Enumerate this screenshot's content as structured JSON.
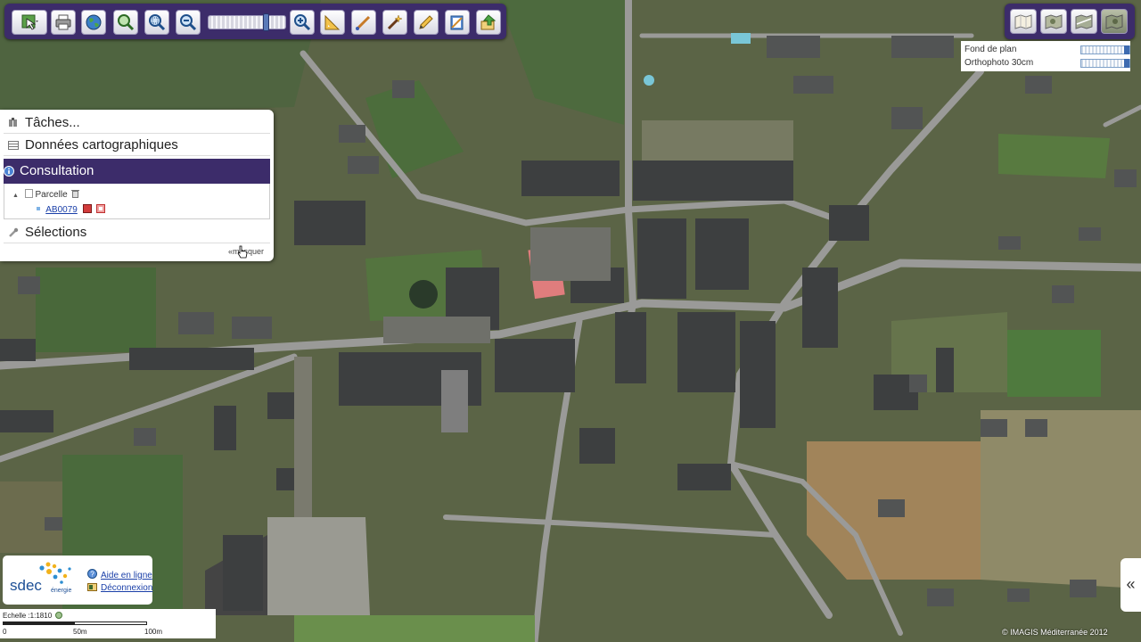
{
  "toolbar": {
    "buttons": [
      "select-area",
      "print",
      "globe-full-extent",
      "zoom-to-selection",
      "zoom-box",
      "zoom-out",
      "zoom-in",
      "measure",
      "draw-line",
      "magic-wand",
      "edit",
      "notes",
      "export"
    ],
    "zoom_level": 0.75
  },
  "layers": {
    "items": [
      {
        "name": "Fond de plan",
        "opacity": 1.0
      },
      {
        "name": "Orthophoto 30cm",
        "opacity": 1.0
      }
    ],
    "buttons": [
      "layer-1",
      "layer-2",
      "layer-3",
      "layer-4"
    ],
    "active_index": 3
  },
  "panel": {
    "taches": "Tâches...",
    "donnees": "Données cartographiques",
    "consultation": "Consultation",
    "tree": {
      "parent_label": "Parcelle",
      "child_label": "AB0079"
    },
    "selections": "Sélections",
    "masquer": "«masquer"
  },
  "branding": {
    "logo_text": "sdec",
    "logo_sub": "énergie",
    "help_link": "Aide en ligne",
    "logout_link": "Déconnexion"
  },
  "scale": {
    "label": "Echelle :1:1810",
    "tick_0": "0",
    "tick_50": "50m",
    "tick_100": "100m"
  },
  "copyright": "© IMAGIS Méditerranée 2012",
  "colors": {
    "toolbar_bg": "#3c2c6a",
    "accent": "#3c2c6a",
    "link": "#1a3fa8"
  }
}
